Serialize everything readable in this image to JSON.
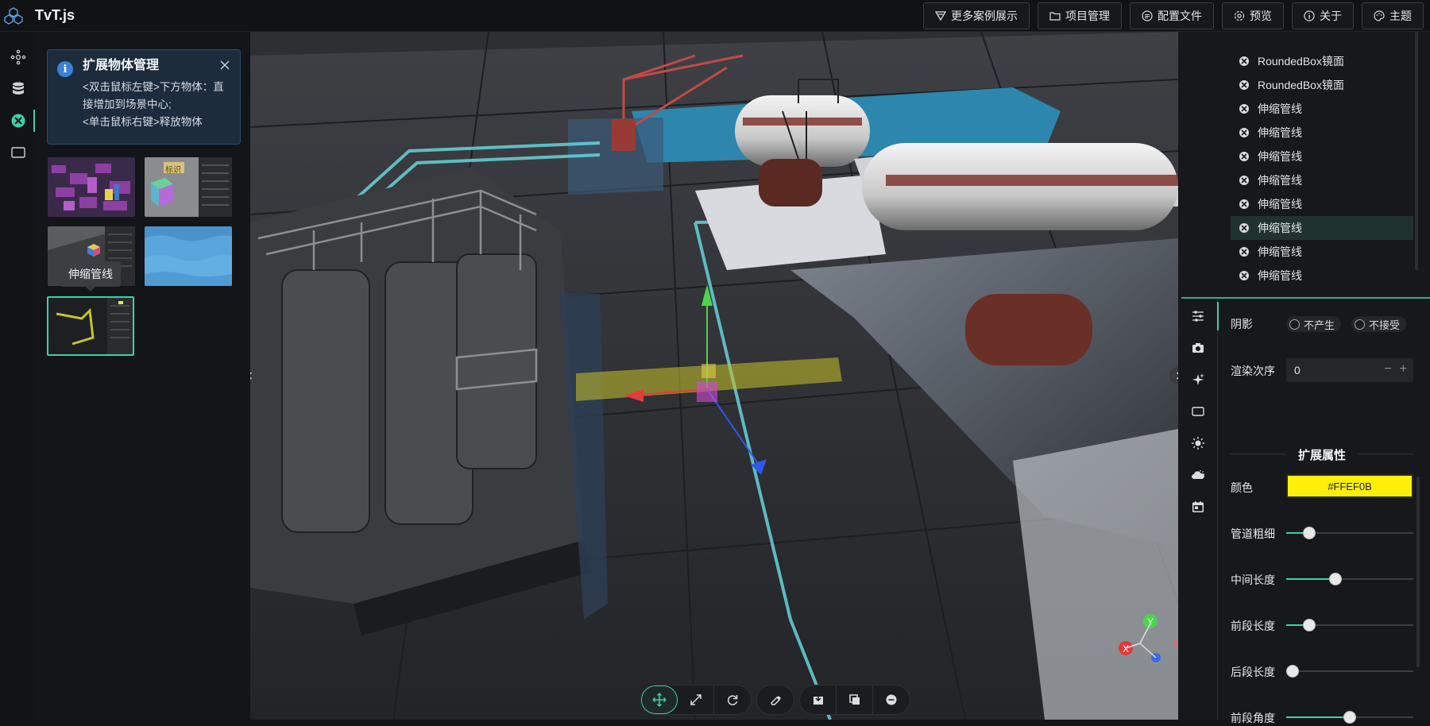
{
  "app": {
    "title": "TvT.js"
  },
  "topbar": {
    "buttons": [
      {
        "label": "更多案例展示",
        "icon": "showcase-icon"
      },
      {
        "label": "项目管理",
        "icon": "folder-icon"
      },
      {
        "label": "配置文件",
        "icon": "config-icon"
      },
      {
        "label": "预览",
        "icon": "preview-icon"
      },
      {
        "label": "关于",
        "icon": "info-icon"
      },
      {
        "label": "主题",
        "icon": "palette-icon"
      }
    ]
  },
  "left_rail": {
    "items": [
      "scene-graph-icon",
      "database-icon",
      "extension-objects-icon",
      "frame-icon"
    ],
    "active_index": 2
  },
  "left_panel": {
    "info": {
      "title": "扩展物体管理",
      "line1": "<双击鼠标左键>下方物体：直接增加到场景中心;",
      "line2": "<单击鼠标右键>释放物体"
    },
    "thumbnails": [
      {
        "name": "city-blocks-thumbnail",
        "badge": ""
      },
      {
        "name": "label-thumbnail",
        "badge": "标识"
      },
      {
        "name": "cube-thumbnail",
        "badge": ""
      },
      {
        "name": "water-thumbnail",
        "badge": ""
      },
      {
        "name": "pipe-thumbnail",
        "badge": ""
      }
    ],
    "tooltip": "伸缩管线"
  },
  "toolbar": {
    "group1": [
      "move-icon",
      "scale-icon",
      "rotate-icon"
    ],
    "group2": [
      "eraser-icon"
    ],
    "group3": [
      "export-icon",
      "copy-icon",
      "remove-icon"
    ]
  },
  "right_panel": {
    "tree_items": [
      {
        "label": "RoundedBox镜面",
        "selected": false
      },
      {
        "label": "RoundedBox镜面",
        "selected": false
      },
      {
        "label": "伸缩管线",
        "selected": false
      },
      {
        "label": "伸缩管线",
        "selected": false
      },
      {
        "label": "伸缩管线",
        "selected": false
      },
      {
        "label": "伸缩管线",
        "selected": false
      },
      {
        "label": "伸缩管线",
        "selected": false
      },
      {
        "label": "伸缩管线",
        "selected": true
      },
      {
        "label": "伸缩管线",
        "selected": false
      },
      {
        "label": "伸缩管线",
        "selected": false
      }
    ],
    "tabs": [
      "sliders-icon",
      "camera-icon",
      "sparkle-icon",
      "frame-icon",
      "sun-icon",
      "weather-icon",
      "calendar-icon"
    ],
    "props": {
      "shadow_label": "阴影",
      "shadow_cast": "不产生",
      "shadow_receive": "不接受",
      "render_order_label": "渲染次序",
      "render_order_value": "0",
      "section_title": "扩展属性",
      "color_label": "颜色",
      "color_value": "#FFEF0B",
      "sliders": [
        {
          "label": "管道粗细",
          "value": 0.18
        },
        {
          "label": "中间长度",
          "value": 0.39
        },
        {
          "label": "前段长度",
          "value": 0.18
        },
        {
          "label": "后段长度",
          "value": 0.05
        },
        {
          "label": "前段角度",
          "value": 0.5
        }
      ]
    }
  },
  "colors": {
    "accent": "#3fd0a9",
    "pipe": "#FFEF0B"
  }
}
